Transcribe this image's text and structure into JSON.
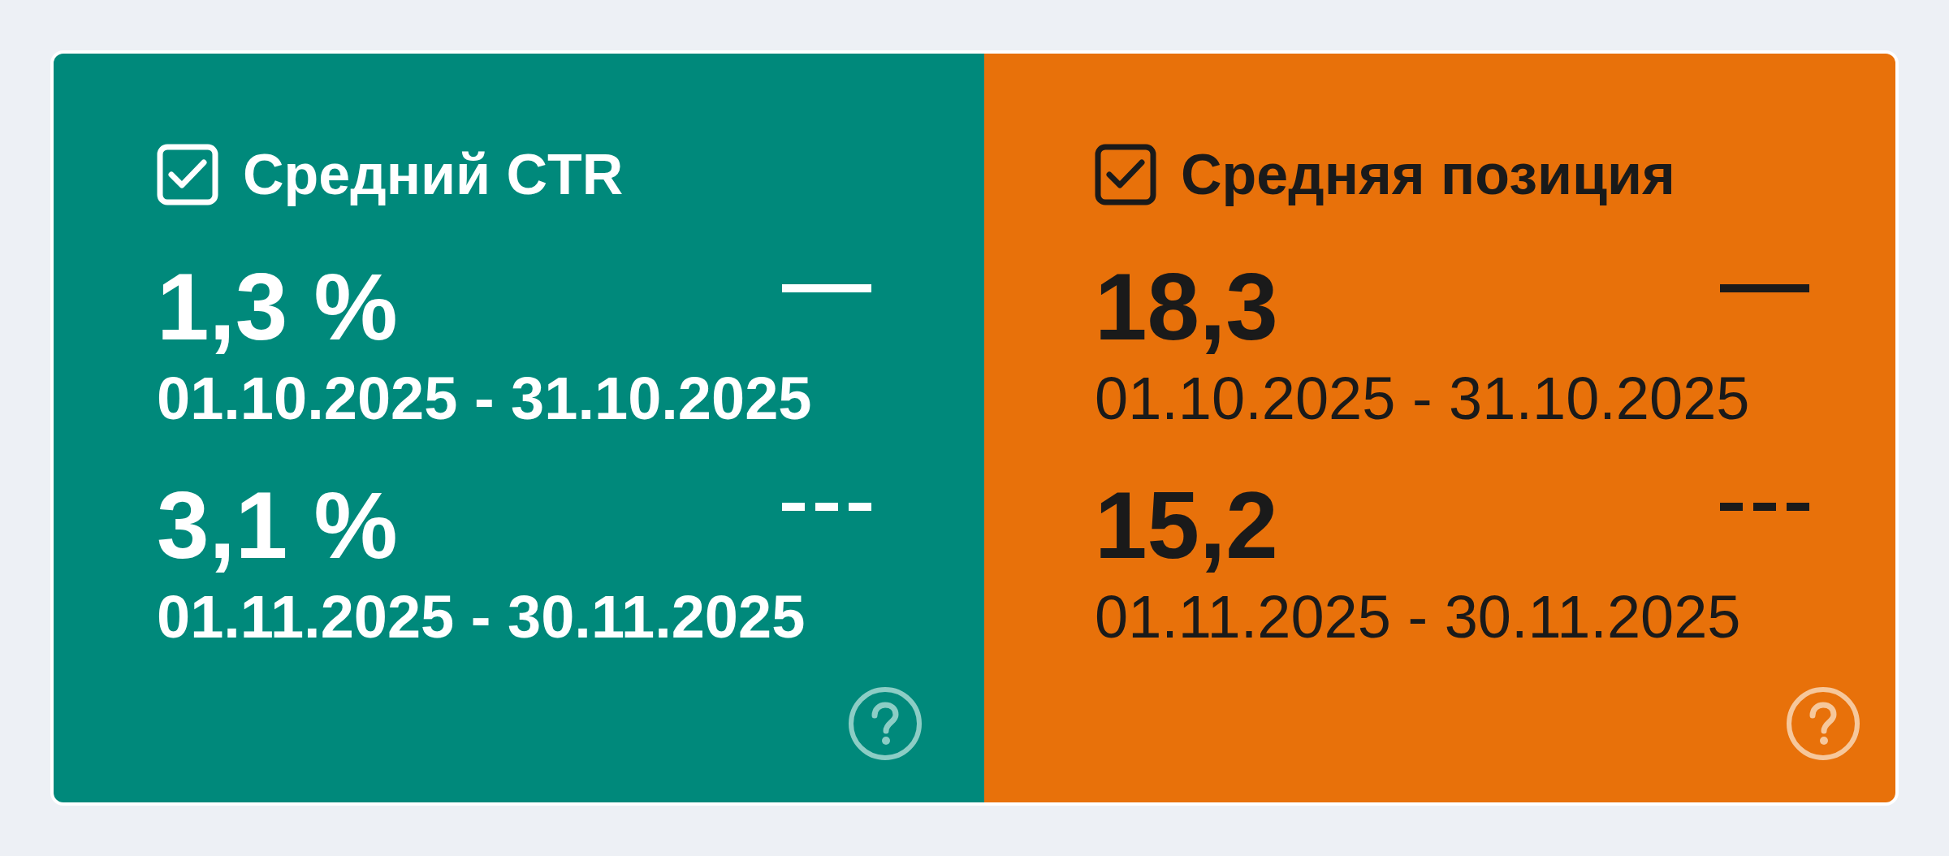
{
  "metrics": [
    {
      "label": "Средний CTR",
      "checked": true,
      "color": "#00897b",
      "periods": [
        {
          "value": "1,3 %",
          "range": "01.10.2025 - 31.10.2025",
          "kind": "solid"
        },
        {
          "value": "3,1 %",
          "range": "01.11.2025 - 30.11.2025",
          "kind": "dashed"
        }
      ]
    },
    {
      "label": "Средняя позиция",
      "checked": true,
      "color": "#e8710a",
      "periods": [
        {
          "value": "18,3",
          "range": "01.10.2025 - 31.10.2025",
          "kind": "solid"
        },
        {
          "value": "15,2",
          "range": "01.11.2025 - 30.11.2025",
          "kind": "dashed"
        }
      ]
    }
  ]
}
